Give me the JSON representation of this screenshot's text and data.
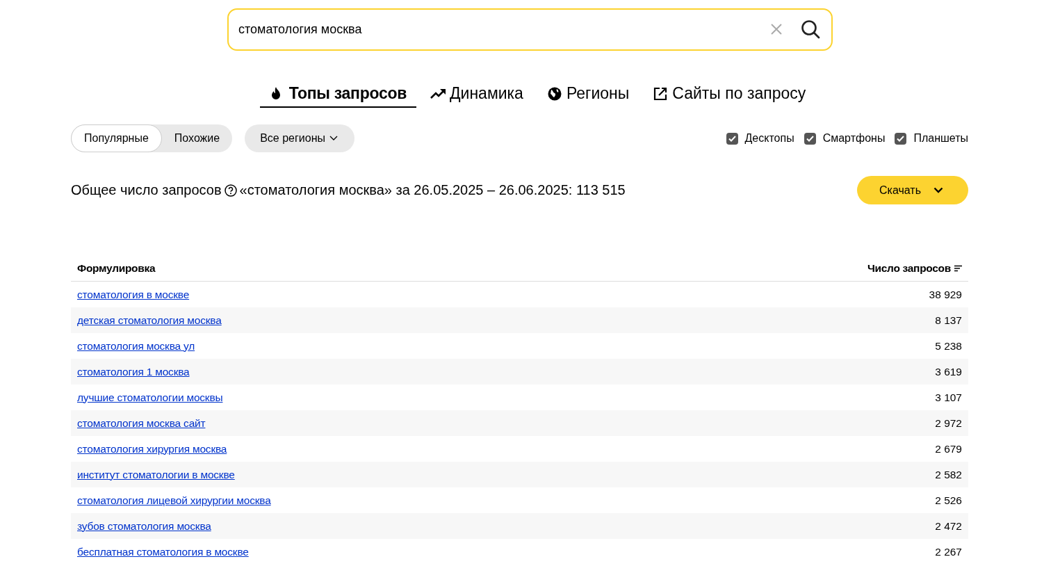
{
  "search": {
    "value": "стоматология москва"
  },
  "tabs": [
    {
      "label": "Топы запросов",
      "kind": "fire",
      "selected": true
    },
    {
      "label": "Динамика",
      "kind": "trend",
      "selected": false
    },
    {
      "label": "Регионы",
      "kind": "globe",
      "selected": false
    },
    {
      "label": "Сайты по запросу",
      "kind": "external",
      "selected": false
    }
  ],
  "mode_toggle": [
    {
      "label": "Популярные",
      "selected": true
    },
    {
      "label": "Похожие",
      "selected": false
    }
  ],
  "region_dropdown": {
    "label": "Все регионы"
  },
  "devices": [
    {
      "label": "Десктопы",
      "checked": true
    },
    {
      "label": "Смартфоны",
      "checked": true
    },
    {
      "label": "Планшеты",
      "checked": true
    }
  ],
  "summary": {
    "label": "Общее число запросов",
    "value": "«стоматология москва» за 26.05.2025 – 26.06.2025: 113 515"
  },
  "download_button": {
    "label": "Скачать"
  },
  "table": {
    "columns": [
      "Формулировка",
      "Число запросов"
    ],
    "rows": [
      {
        "phrase": "стоматология в москве",
        "count": "38 929"
      },
      {
        "phrase": "детская стоматология москва",
        "count": "8 137"
      },
      {
        "phrase": "стоматология москва ул",
        "count": "5 238"
      },
      {
        "phrase": "стоматология 1 москва",
        "count": "3 619"
      },
      {
        "phrase": "лучшие стоматологии москвы",
        "count": "3 107"
      },
      {
        "phrase": "стоматология москва сайт",
        "count": "2 972"
      },
      {
        "phrase": "стоматология хирургия москва",
        "count": "2 679"
      },
      {
        "phrase": "институт стоматологии в москве",
        "count": "2 582"
      },
      {
        "phrase": "стоматология лицевой хирургии москва",
        "count": "2 526"
      },
      {
        "phrase": "зубов стоматология москва",
        "count": "2 472"
      },
      {
        "phrase": "бесплатная стоматология в москве",
        "count": "2 267"
      }
    ]
  }
}
